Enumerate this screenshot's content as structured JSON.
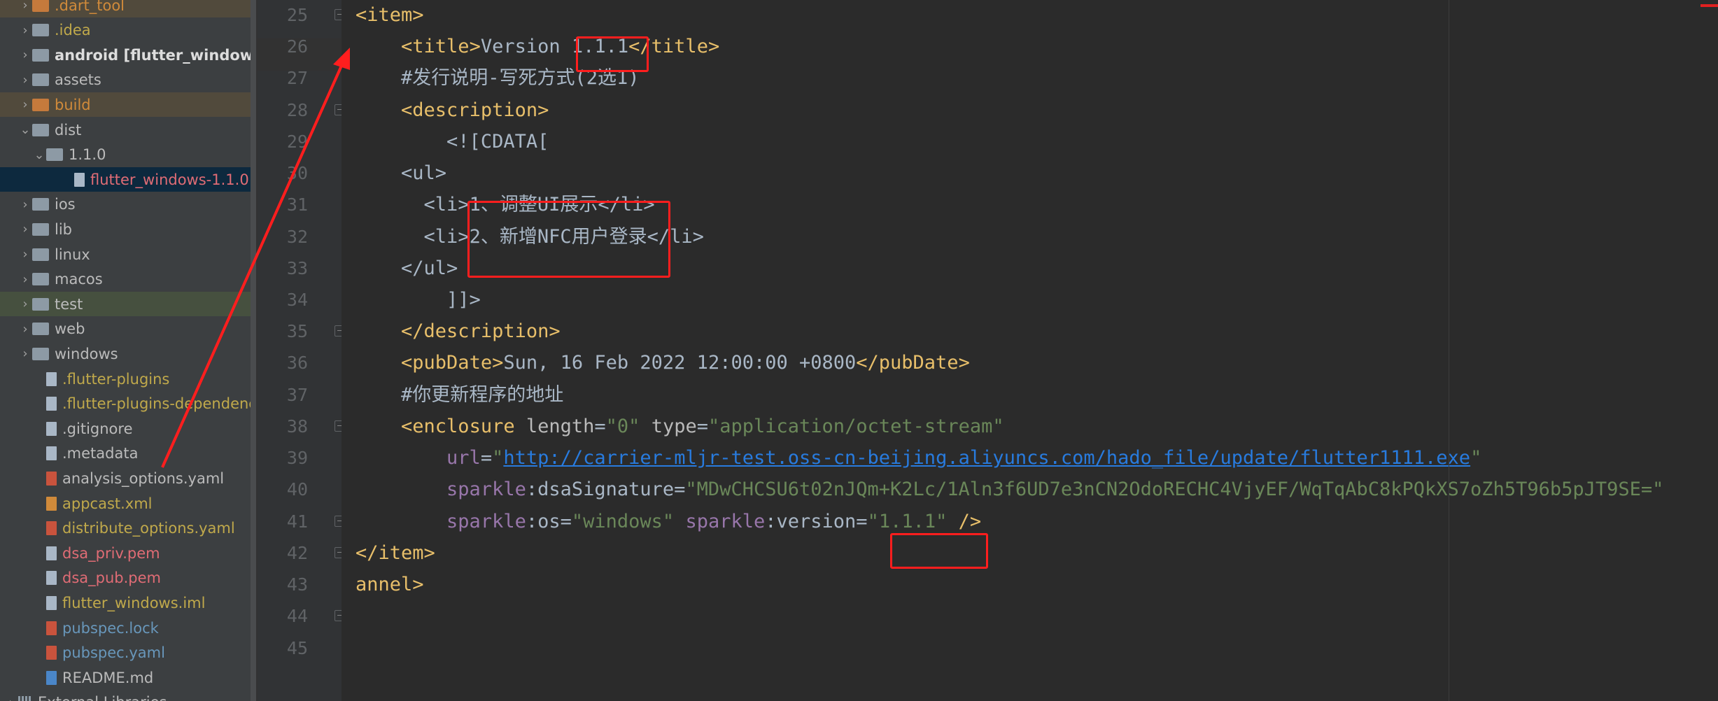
{
  "project_tree": [
    {
      "label": ".dart_tool",
      "indent": 1,
      "chevron": "right",
      "icon": "folder",
      "iconColor": "orange",
      "textColor": "#d08a3a",
      "hl": "orange"
    },
    {
      "label": ".idea",
      "indent": 1,
      "chevron": "right",
      "icon": "folder",
      "textColor": "#c0a94b"
    },
    {
      "label": "android [flutter_windows_a",
      "indent": 1,
      "chevron": "right",
      "icon": "folder",
      "bold": true,
      "textColor": "#dddddd"
    },
    {
      "label": "assets",
      "indent": 1,
      "chevron": "right",
      "icon": "folder"
    },
    {
      "label": "build",
      "indent": 1,
      "chevron": "right",
      "icon": "folder",
      "iconColor": "orange",
      "textColor": "#d08a3a",
      "hl": "orange"
    },
    {
      "label": "dist",
      "indent": 1,
      "chevron": "down",
      "icon": "folder"
    },
    {
      "label": "1.1.0",
      "indent": 2,
      "chevron": "down",
      "icon": "folder"
    },
    {
      "label": "flutter_windows-1.1.0",
      "indent": 4,
      "chevron": "",
      "icon": "file",
      "textColor": "#e06c75",
      "selected": true
    },
    {
      "label": "ios",
      "indent": 1,
      "chevron": "right",
      "icon": "folder"
    },
    {
      "label": "lib",
      "indent": 1,
      "chevron": "right",
      "icon": "folder"
    },
    {
      "label": "linux",
      "indent": 1,
      "chevron": "right",
      "icon": "folder"
    },
    {
      "label": "macos",
      "indent": 1,
      "chevron": "right",
      "icon": "folder"
    },
    {
      "label": "test",
      "indent": 1,
      "chevron": "right",
      "icon": "folder",
      "hl": "green"
    },
    {
      "label": "web",
      "indent": 1,
      "chevron": "right",
      "icon": "folder"
    },
    {
      "label": "windows",
      "indent": 1,
      "chevron": "right",
      "icon": "folder"
    },
    {
      "label": ".flutter-plugins",
      "indent": 2,
      "chevron": "",
      "icon": "file",
      "textColor": "#c0a94b"
    },
    {
      "label": ".flutter-plugins-dependenci",
      "indent": 2,
      "chevron": "",
      "icon": "file",
      "textColor": "#c0a94b"
    },
    {
      "label": ".gitignore",
      "indent": 2,
      "chevron": "",
      "icon": "file"
    },
    {
      "label": ".metadata",
      "indent": 2,
      "chevron": "",
      "icon": "file"
    },
    {
      "label": "analysis_options.yaml",
      "indent": 2,
      "chevron": "",
      "icon": "file",
      "iconColor": "yml"
    },
    {
      "label": "appcast.xml",
      "indent": 2,
      "chevron": "",
      "icon": "file",
      "iconColor": "xml",
      "textColor": "#c0a94b"
    },
    {
      "label": "distribute_options.yaml",
      "indent": 2,
      "chevron": "",
      "icon": "file",
      "iconColor": "yml",
      "textColor": "#c0a94b"
    },
    {
      "label": "dsa_priv.pem",
      "indent": 2,
      "chevron": "",
      "icon": "file",
      "textColor": "#e06c75"
    },
    {
      "label": "dsa_pub.pem",
      "indent": 2,
      "chevron": "",
      "icon": "file",
      "textColor": "#e06c75"
    },
    {
      "label": "flutter_windows.iml",
      "indent": 2,
      "chevron": "",
      "icon": "file",
      "textColor": "#c0a94b"
    },
    {
      "label": "pubspec.lock",
      "indent": 2,
      "chevron": "",
      "icon": "file",
      "iconColor": "yml",
      "textColor": "#6897bb"
    },
    {
      "label": "pubspec.yaml",
      "indent": 2,
      "chevron": "",
      "icon": "file",
      "iconColor": "yml",
      "textColor": "#6897bb"
    },
    {
      "label": "README.md",
      "indent": 2,
      "chevron": "",
      "icon": "file",
      "iconColor": "md"
    },
    {
      "label": "External Libraries",
      "indent": 0,
      "chevron": "right",
      "icon": "libs"
    }
  ],
  "line_numbers": [
    "25",
    "26",
    "27",
    "28",
    "29",
    "30",
    "31",
    "32",
    "33",
    "34",
    "35",
    "36",
    "37",
    "38",
    "39",
    "40",
    "41",
    "42",
    "43",
    "44",
    "45"
  ],
  "code_lines": [
    {
      "indent": "",
      "tokens": [
        [
          "tag",
          "<item>"
        ]
      ]
    },
    {
      "indent": "    ",
      "tokens": [
        [
          "tag",
          "<title>"
        ],
        [
          "text",
          "Version 1.1.1"
        ],
        [
          "tag",
          "</title>"
        ]
      ]
    },
    {
      "indent": "    ",
      "tokens": [
        [
          "text",
          "#发行说明-写死方式(2选1)"
        ]
      ]
    },
    {
      "indent": "    ",
      "tokens": [
        [
          "tag",
          "<description>"
        ]
      ]
    },
    {
      "indent": "        ",
      "tokens": [
        [
          "text",
          "<![CDATA["
        ]
      ]
    },
    {
      "indent": "    ",
      "tokens": [
        [
          "text",
          "<ul>"
        ]
      ]
    },
    {
      "indent": "      ",
      "tokens": [
        [
          "text",
          "<li>1、调整UI展示</li>"
        ]
      ]
    },
    {
      "indent": "      ",
      "tokens": [
        [
          "text",
          "<li>2、新增NFC用户登录</li>"
        ]
      ]
    },
    {
      "indent": "    ",
      "tokens": [
        [
          "text",
          "</ul>"
        ]
      ]
    },
    {
      "indent": "        ",
      "tokens": [
        [
          "text",
          "]]>"
        ]
      ]
    },
    {
      "indent": "    ",
      "tokens": [
        [
          "tag",
          "</description>"
        ]
      ]
    },
    {
      "indent": "    ",
      "tokens": [
        [
          "tag",
          "<pubDate>"
        ],
        [
          "text",
          "Sun, 16 Feb 2022 12:00:00 +0800"
        ],
        [
          "tag",
          "</pubDate>"
        ]
      ]
    },
    {
      "indent": "    ",
      "tokens": [
        [
          "text",
          "#你更新程序的地址"
        ]
      ]
    },
    {
      "indent": "    ",
      "tokens": [
        [
          "tag",
          "<enclosure "
        ],
        [
          "attr",
          "length"
        ],
        [
          "text",
          "="
        ],
        [
          "str",
          "\"0\""
        ],
        [
          "text",
          " "
        ],
        [
          "attr",
          "type"
        ],
        [
          "text",
          "="
        ],
        [
          "str",
          "\"application/octet-stream\""
        ]
      ]
    },
    {
      "indent": "        ",
      "tokens": [
        [
          "ns",
          "url"
        ],
        [
          "text",
          "="
        ],
        [
          "str",
          "\""
        ],
        [
          "url",
          "http://carrier-mljr-test.oss-cn-beijing.aliyuncs.com/hado_file/update/flutter1111.exe"
        ],
        [
          "str",
          "\""
        ]
      ]
    },
    {
      "indent": "        ",
      "tokens": [
        [
          "ns",
          "sparkle"
        ],
        [
          "text",
          ":dsaSignature="
        ],
        [
          "str",
          "\"MDwCHCSU6t02nJQm+K2Lc/1Aln3f6UD7e3nCN2OdoRECHC4VjyEF/WqTqAbC8kPQkXS7oZh5T96b5pJT9SE=\""
        ]
      ]
    },
    {
      "indent": "        ",
      "tokens": [
        [
          "ns",
          "sparkle"
        ],
        [
          "text",
          ":os="
        ],
        [
          "str",
          "\"windows\""
        ],
        [
          "text",
          " "
        ],
        [
          "ns",
          "sparkle"
        ],
        [
          "text",
          ":version="
        ],
        [
          "str",
          "\"1.1.1\""
        ],
        [
          "text",
          " "
        ],
        [
          "tag",
          "/>"
        ]
      ]
    },
    {
      "indent": "",
      "tokens": [
        [
          "tag",
          "</item>"
        ]
      ]
    },
    {
      "indent": "",
      "tokens": [
        [
          "tag",
          "annel>"
        ]
      ]
    },
    {
      "indent": "",
      "tokens": []
    },
    {
      "indent": "",
      "tokens": []
    }
  ],
  "colors": {
    "annotation_red": "#ff1e1e",
    "tag": "#e8bf6a",
    "string": "#6a8759",
    "namespace": "#9876aa",
    "link": "#287bde"
  }
}
